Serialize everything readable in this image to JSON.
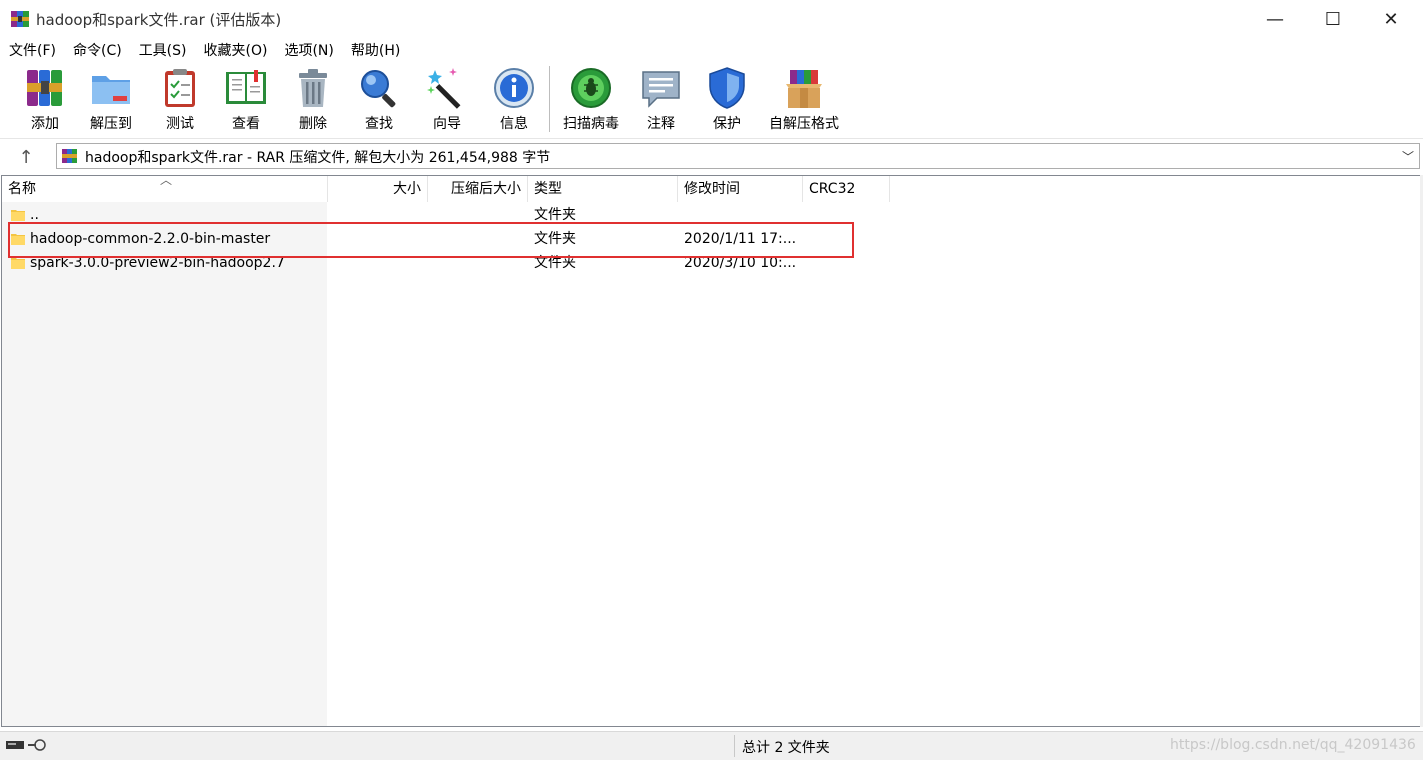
{
  "window": {
    "title": "hadoop和spark文件.rar (评估版本)",
    "minimize": "—",
    "maximize": "☐",
    "close": "✕"
  },
  "menu": [
    {
      "label": "文件(F)"
    },
    {
      "label": "命令(C)"
    },
    {
      "label": "工具(S)"
    },
    {
      "label": "收藏夹(O)"
    },
    {
      "label": "选项(N)"
    },
    {
      "label": "帮助(H)"
    }
  ],
  "toolbar": {
    "items": [
      {
        "label": "添加",
        "icon": "add-archive-icon"
      },
      {
        "label": "解压到",
        "icon": "extract-to-folder-icon"
      },
      {
        "label": "测试",
        "icon": "test-clipboard-icon"
      },
      {
        "label": "查看",
        "icon": "view-book-icon"
      },
      {
        "label": "删除",
        "icon": "delete-trash-icon"
      },
      {
        "label": "查找",
        "icon": "find-magnifier-icon"
      },
      {
        "label": "向导",
        "icon": "wizard-wand-icon"
      },
      {
        "label": "信息",
        "icon": "info-icon"
      },
      {
        "label": "扫描病毒",
        "icon": "virus-scan-icon"
      },
      {
        "label": "注释",
        "icon": "comment-icon"
      },
      {
        "label": "保护",
        "icon": "protect-shield-icon"
      },
      {
        "label": "自解压格式",
        "icon": "sfx-box-icon"
      }
    ]
  },
  "address": {
    "up": "↑",
    "text": "hadoop和spark文件.rar - RAR 压缩文件, 解包大小为 261,454,988 字节",
    "dropdown": "﹀"
  },
  "columns": {
    "name": "名称",
    "size": "大小",
    "packed": "压缩后大小",
    "type": "类型",
    "modified": "修改时间",
    "crc": "CRC32",
    "sort_indicator": "︿"
  },
  "rows": [
    {
      "name": "..",
      "type": "文件夹",
      "modified": ""
    },
    {
      "name": "hadoop-common-2.2.0-bin-master",
      "type": "文件夹",
      "modified": "2020/1/11 17:..."
    },
    {
      "name": "spark-3.0.0-preview2-bin-hadoop2.7",
      "type": "文件夹",
      "modified": "2020/3/10 10:..."
    }
  ],
  "status": {
    "summary": "总计 2 文件夹",
    "watermark": "https://blog.csdn.net/qq_42091436"
  },
  "colors": {
    "highlight": "#e03030",
    "folder": "#f4c542"
  }
}
